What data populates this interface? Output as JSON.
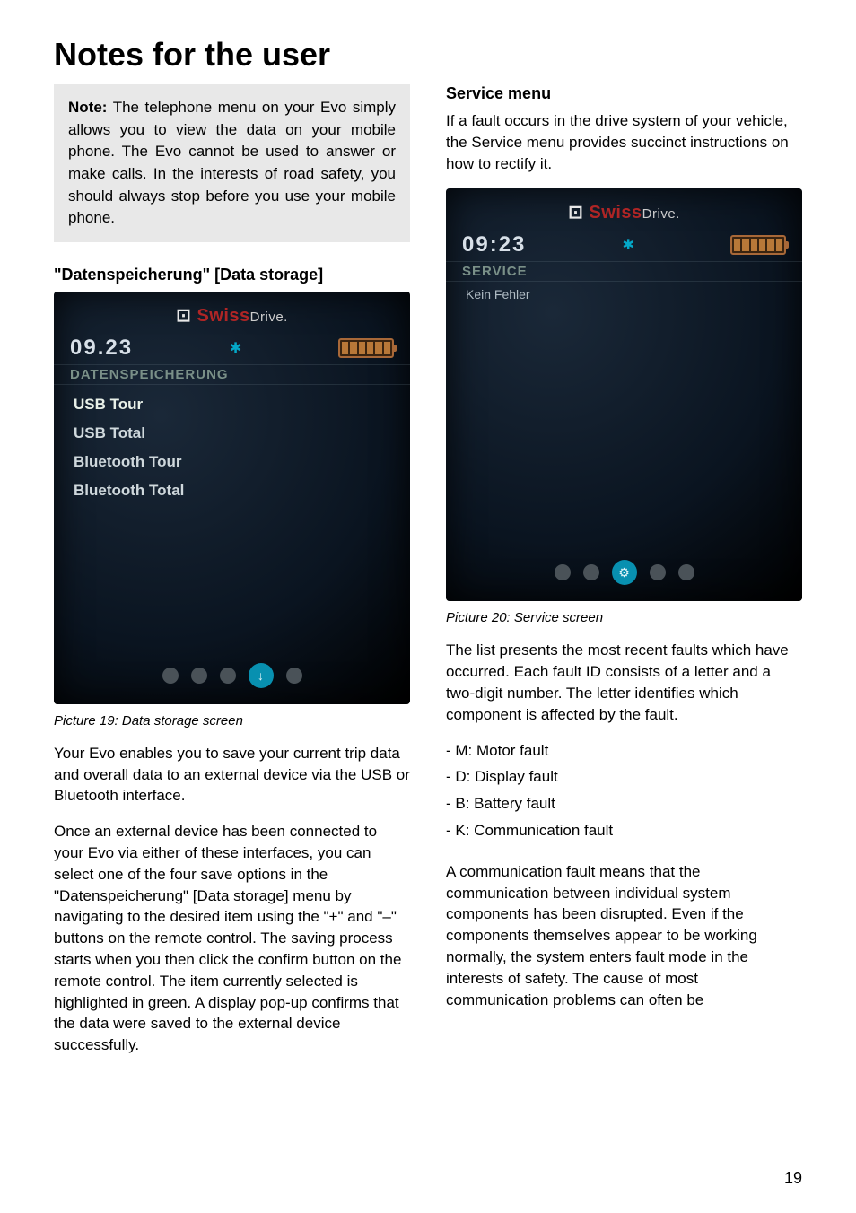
{
  "page_title": "Notes for the user",
  "page_number": "19",
  "left": {
    "note_label": "Note:",
    "note_text": " The telephone menu on your Evo simply allows you to view the data on your mobile phone. The Evo cannot be used to answer or make calls. In the interests of road safety, you should always stop before you use your mobile phone.",
    "section_heading": "\"Datenspeicherung\" [Data storage]",
    "shot": {
      "logo_swiss": "Swiss",
      "logo_drive": "Drive.",
      "time": "09.23",
      "header": "DATENSPEICHERUNG",
      "items": [
        "USB Tour",
        "USB Total",
        "Bluetooth Tour",
        "Bluetooth Total"
      ],
      "active_icon": "↓"
    },
    "caption": "Picture 19: Data storage screen",
    "para1": "Your Evo enables you to save your current trip data and overall data to an external device via the USB or Bluetooth interface.",
    "para2": "Once an external device has been connected to your Evo via either of these interfaces, you can select one of the four save options in the \"Datenspeicherung\" [Data storage] menu by navigating to the desired item using the \"+\" and \"–\" buttons on the remote control. The saving process starts when you then click the confirm button on the remote control. The item currently selected is highlighted in green. A display pop-up confirms that the data were saved to the external device successfully."
  },
  "right": {
    "section_heading": "Service menu",
    "intro": "If a fault occurs in the drive system of your vehicle, the Service menu provides succinct instructions on how to rectify it.",
    "shot": {
      "logo_swiss": "Swiss",
      "logo_drive": "Drive.",
      "time": "09:23",
      "header": "SERVICE",
      "body": "Kein Fehler",
      "active_icon": "⚙"
    },
    "caption": "Picture 20: Service screen",
    "para1": "The list presents the most recent faults which have occurred. Each fault ID consists of a letter and a two-digit number. The letter identifies which component is affected by the fault.",
    "faults": [
      "- M: Motor fault",
      "- D: Display fault",
      "- B: Battery fault",
      "- K: Communication fault"
    ],
    "para2": "A communication fault means that the communication between individual system components has been disrupted. Even if the components themselves appear to be working normally, the system enters fault mode in the interests of safety. The cause of most communication problems can often be"
  }
}
